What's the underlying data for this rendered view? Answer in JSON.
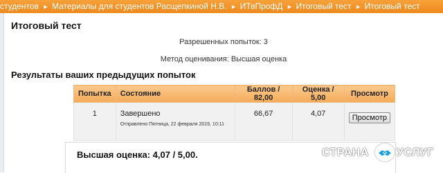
{
  "breadcrumb": [
    {
      "label": "студентов",
      "current": false
    },
    {
      "label": "Материалы для студентов Расщепкиной Н.В.",
      "current": false
    },
    {
      "label": "ИТвПрофД",
      "current": false
    },
    {
      "label": "Итоговый тест",
      "current": true
    },
    {
      "label": "Итоговый тест",
      "current": false
    }
  ],
  "page": {
    "title": "Итоговый тест",
    "attempts_allowed": "Разрешенных попыток: 3",
    "grading_method": "Метод оценивания: Высшая оценка",
    "results_heading": "Результаты ваших предыдущих попыток"
  },
  "table": {
    "headers": {
      "attempt": "Попытка",
      "state": "Состояние",
      "points": "Баллов / 82,00",
      "grade": "Оценка / 5,00",
      "review": "Просмотр"
    },
    "rows": [
      {
        "attempt": "1",
        "state": "Завершено",
        "submitted": "Отправлено Пятница, 22 февраля 2019, 10:11",
        "points": "66,67",
        "grade": "4,07",
        "review_button": "Просмотр"
      }
    ]
  },
  "best_grade": "Высшая оценка: 4,07 / 5,00.",
  "watermark": {
    "left": "СТРАНА",
    "right": "УСЛУГ",
    "icon": "handshake-icon"
  },
  "colors": {
    "accent": "#ee8a1e",
    "header": "#f4ab58"
  }
}
